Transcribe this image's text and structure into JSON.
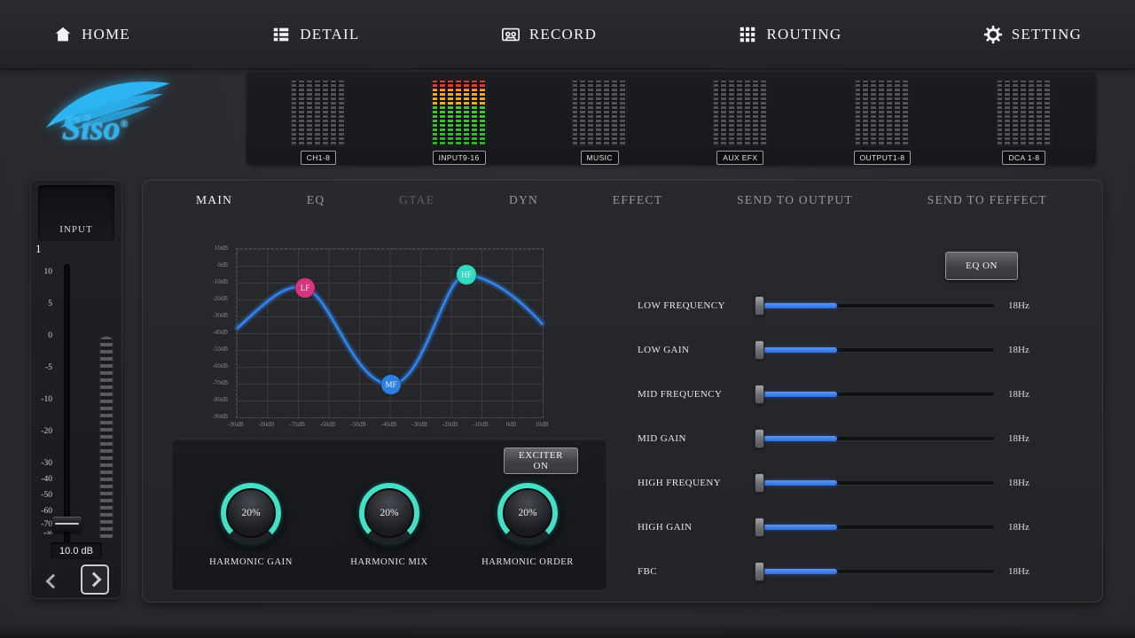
{
  "nav": {
    "items": [
      {
        "label": "HOME",
        "icon": "home-icon"
      },
      {
        "label": "DETAIL",
        "icon": "detail-icon"
      },
      {
        "label": "RECORD",
        "icon": "record-icon"
      },
      {
        "label": "ROUTING",
        "icon": "routing-icon"
      },
      {
        "label": "SETTING",
        "icon": "setting-icon"
      }
    ]
  },
  "logo": {
    "text": "Siso",
    "reg": "®"
  },
  "meters": {
    "items": [
      {
        "label": "CH1-8",
        "active": false
      },
      {
        "label": "INPUT9-16",
        "active": true
      },
      {
        "label": "MUSIC",
        "active": false
      },
      {
        "label": "AUX EFX",
        "active": false
      },
      {
        "label": "OUTPUT1-8",
        "active": false
      },
      {
        "label": "DCA 1-8",
        "active": false
      }
    ]
  },
  "fader": {
    "title": "INPUT",
    "channel": "1",
    "scale": [
      "10",
      "5",
      "0",
      "-5",
      "-10",
      "-20",
      "-30",
      "-40",
      "-50",
      "-60",
      "-70",
      "-∞"
    ],
    "value": "10.0 dB"
  },
  "tabs": {
    "items": [
      {
        "label": "MAIN",
        "state": "active"
      },
      {
        "label": "EQ",
        "state": "normal"
      },
      {
        "label": "GTAE",
        "state": "dim"
      },
      {
        "label": "DYN",
        "state": "normal"
      },
      {
        "label": "EFFECT",
        "state": "normal"
      },
      {
        "label": "SEND TO OUTPUT",
        "state": "normal"
      },
      {
        "label": "SEND TO FEFFECT",
        "state": "normal"
      }
    ]
  },
  "eq_on_button": "EQ ON",
  "eq_graph": {
    "y_labels": [
      "10dB",
      "0dB",
      "-10dB",
      "-20dB",
      "-30dB",
      "-40dB",
      "-50dB",
      "-60dB",
      "-70dB",
      "-80dB",
      "-90dB"
    ],
    "x_labels": [
      "-90dB",
      "-80dB",
      "-70dB",
      "-60dB",
      "-50dB",
      "-40dB",
      "-30dB",
      "-20dB",
      "-10dB",
      "0dB",
      "10dB"
    ],
    "curve_color": "#2f80e8",
    "nodes": [
      {
        "label": "LF",
        "color": "#d6347f"
      },
      {
        "label": "MF",
        "color": "#2f7fe0"
      },
      {
        "label": "HF",
        "color": "#35d8c0"
      }
    ]
  },
  "exciter": {
    "button": "EXCITER ON",
    "accent": "#43dfc6",
    "knobs": [
      {
        "label": "HARMONIC GAIN",
        "value": "20%"
      },
      {
        "label": "HARMONIC MIX",
        "value": "20%"
      },
      {
        "label": "HARMONIC ORDER",
        "value": "20%"
      }
    ]
  },
  "eq_params": {
    "slider_color": "#2f6fe0",
    "items": [
      {
        "label": "LOW FREQUENCY",
        "value": "18Hz",
        "fill": 31
      },
      {
        "label": "LOW GAIN",
        "value": "18Hz",
        "fill": 31
      },
      {
        "label": "MID FREQUENCY",
        "value": "18Hz",
        "fill": 31
      },
      {
        "label": "MID GAIN",
        "value": "18Hz",
        "fill": 31
      },
      {
        "label": "HIGH FREQUENY",
        "value": "18Hz",
        "fill": 31
      },
      {
        "label": "HIGH GAIN",
        "value": "18Hz",
        "fill": 31
      },
      {
        "label": "FBC",
        "value": "18Hz",
        "fill": 31
      }
    ]
  }
}
